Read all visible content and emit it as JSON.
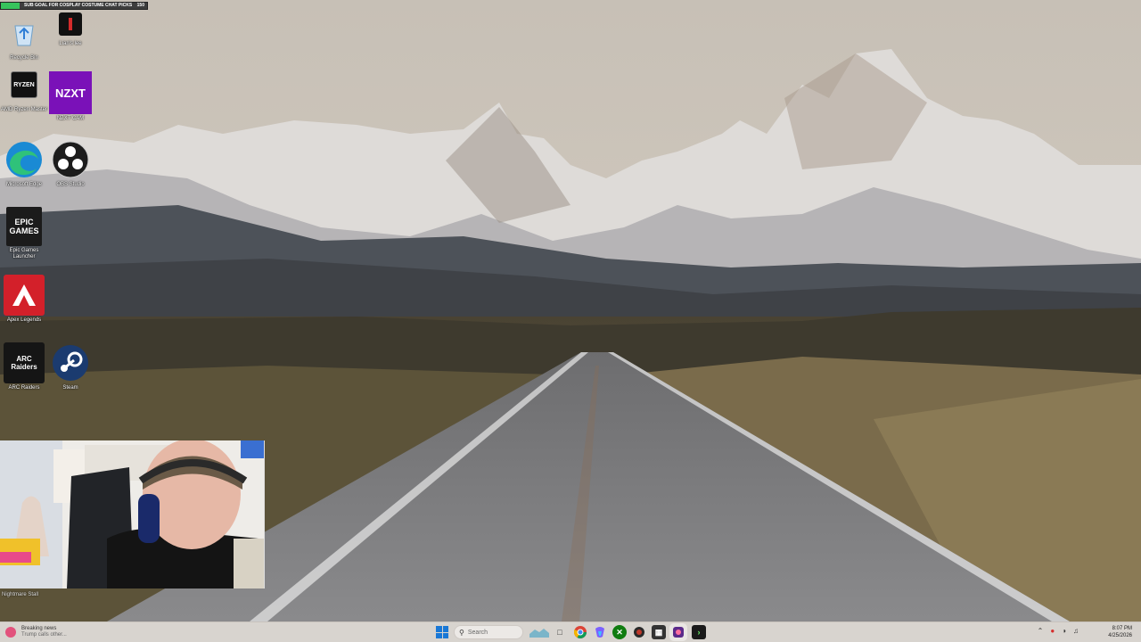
{
  "overlay": {
    "goal_label": "SUB GOAL FOR COSPLAY COSTUME CHAT PICKS",
    "goal_count": "150",
    "goal_progress": 0.13,
    "goal_color": "#37c35c"
  },
  "desktop": {
    "icons": [
      {
        "id": "recycle-bin",
        "label": "Recycle Bin",
        "icon": "recycle-bin-icon"
      },
      {
        "id": "lians-lee",
        "label": "Lian's lee",
        "icon": "red-bar-app-icon"
      },
      {
        "id": "ryzen-master",
        "label": "AMD Ryzen Master",
        "icon": "ryzen-icon",
        "tile_text": "RYZEN"
      },
      {
        "id": "nzxt-cam",
        "label": "NZXT CAM",
        "icon": "nzxt-icon",
        "tile_text": "NZXT"
      },
      {
        "id": "edge",
        "label": "Microsoft Edge",
        "icon": "edge-icon"
      },
      {
        "id": "obs",
        "label": "OBS Studio",
        "icon": "obs-icon"
      },
      {
        "id": "epic",
        "label": "Epic Games Launcher",
        "icon": "epic-games-icon",
        "tile_text": "EPIC GAMES"
      },
      {
        "id": "apex",
        "label": "Apex Legends",
        "icon": "apex-legends-icon"
      },
      {
        "id": "arc-raiders",
        "label": "ARC Raiders",
        "icon": "arc-raiders-icon",
        "tile_text": "ARC Raiders"
      },
      {
        "id": "steam",
        "label": "Steam",
        "icon": "steam-icon"
      }
    ]
  },
  "webcam": {
    "caption": "Nightmare Stall"
  },
  "taskbar": {
    "news_title": "Breaking news",
    "news_subtitle": "Trump calls other...",
    "search_placeholder": "Search",
    "apps": [
      {
        "name": "file-explorer-icon",
        "color": "#f2c12e"
      },
      {
        "name": "chrome-icon",
        "color": "#4285f4"
      },
      {
        "name": "copilot-icon",
        "color": "#7b61ff"
      },
      {
        "name": "xbox-icon",
        "color": "#107c10"
      },
      {
        "name": "app-icon",
        "color": "#c0392b"
      },
      {
        "name": "calculator-icon",
        "color": "#333333"
      },
      {
        "name": "obs-taskbar-icon",
        "color": "#5a2a8a"
      },
      {
        "name": "terminal-icon",
        "color": "#1a1a1a"
      }
    ],
    "time": "8:07 PM",
    "date": "4/25/2026"
  }
}
